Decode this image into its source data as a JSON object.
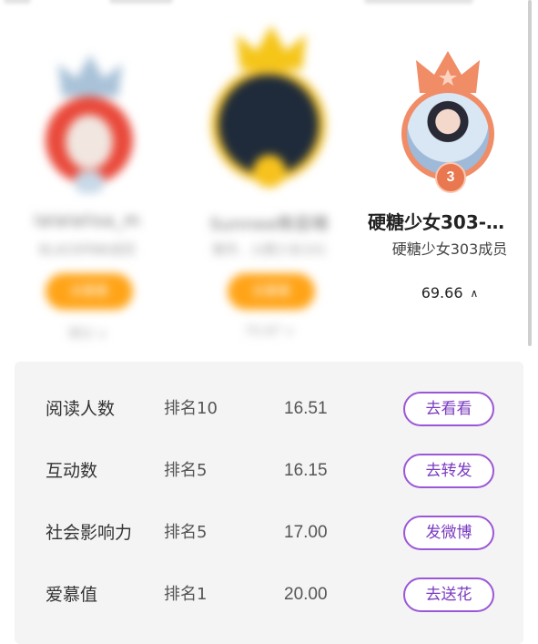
{
  "leaderboard": {
    "cards": [
      {
        "name": "lalalalisa_m",
        "desc": "BLACKPINK成员",
        "button": "去看看",
        "score": "得分 ∨"
      },
      {
        "name": "Sunnee杨芸晴",
        "desc": "歌手、火箭少女101",
        "button": "去看看",
        "score": "70.87 ∨"
      }
    ],
    "rank3": {
      "crown_icon": "crown-icon",
      "badge": "3",
      "name": "硬糖少女303-…",
      "desc": "硬糖少女303成员",
      "score": "69.66",
      "expand_icon": "chevron-up-icon"
    }
  },
  "details": {
    "rows": [
      {
        "label": "阅读人数",
        "rank": "排名10",
        "value": "16.51",
        "action": "去看看"
      },
      {
        "label": "互动数",
        "rank": "排名5",
        "value": "16.15",
        "action": "去转发"
      },
      {
        "label": "社会影响力",
        "rank": "排名5",
        "value": "17.00",
        "action": "发微博"
      },
      {
        "label": "爱慕值",
        "rank": "排名1",
        "value": "20.00",
        "action": "去送花"
      }
    ]
  },
  "colors": {
    "accent_purple": "#9b57d6",
    "orange": "#ffa418",
    "bronze": "#f08c66",
    "gold": "#f5c518",
    "silver": "#a9c2d8"
  }
}
